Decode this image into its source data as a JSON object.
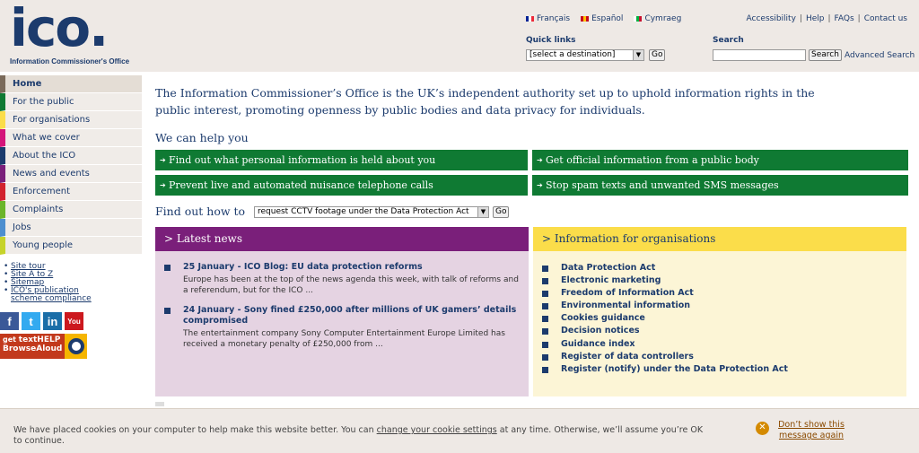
{
  "brand": {
    "logo": "ico.",
    "tagline": "Information Commissioner's Office"
  },
  "languages": [
    {
      "label": "Français",
      "flag": [
        "#002395",
        "#ffffff",
        "#ed2939"
      ]
    },
    {
      "label": "Español",
      "flag": [
        "#c60b1e",
        "#ffc400",
        "#c60b1e"
      ]
    },
    {
      "label": "Cymraeg",
      "flag": [
        "#ffffff",
        "#00b140",
        "#c8102e"
      ]
    }
  ],
  "utility_links": [
    "Accessibility",
    "Help",
    "FAQs",
    "Contact us"
  ],
  "quick_links": {
    "label": "Quick links",
    "selected": "[select a destination]",
    "go": "Go"
  },
  "search": {
    "label": "Search",
    "button": "Search",
    "advanced": "Advanced Search",
    "value": ""
  },
  "nav": [
    {
      "label": "Home",
      "color": "#7a6a5a"
    },
    {
      "label": "For the public",
      "color": "#0f7a33"
    },
    {
      "label": "For organisations",
      "color": "#fbdd4a"
    },
    {
      "label": "What we cover",
      "color": "#d4157a"
    },
    {
      "label": "About the ICO",
      "color": "#1c3b6d"
    },
    {
      "label": "News and events",
      "color": "#7a1f7a"
    },
    {
      "label": "Enforcement",
      "color": "#d2222d"
    },
    {
      "label": "Complaints",
      "color": "#6bb52a"
    },
    {
      "label": "Jobs",
      "color": "#4e8fcf"
    },
    {
      "label": "Young people",
      "color": "#c6d32a"
    }
  ],
  "side_links": [
    "Site tour",
    "Site A to Z",
    "Sitemap",
    "ICO's publication scheme compliance"
  ],
  "social": [
    {
      "icon": "facebook-icon",
      "glyph": "f",
      "color": "#3b5998"
    },
    {
      "icon": "twitter-icon",
      "glyph": "t",
      "color": "#33aaf0"
    },
    {
      "icon": "linkedin-icon",
      "glyph": "in",
      "color": "#1a6ea8"
    },
    {
      "icon": "youtube-icon",
      "glyph": "You",
      "color": "#cc181e"
    }
  ],
  "browsealoud": {
    "line1": "get",
    "line2": "textHELP",
    "line3": "BrowseAloud"
  },
  "intro": "The Information Commissioner’s Office is the UK’s independent authority set up to uphold information rights in the public interest, promoting openness by public bodies and data privacy for individuals.",
  "help": {
    "title": "We can help you",
    "buttons": [
      "Find out what personal information is held about you",
      "Get official information from a public body",
      "Prevent live and automated nuisance telephone calls",
      "Stop spam texts and unwanted SMS messages"
    ]
  },
  "find_out": {
    "label": "Find out how to",
    "selected": "request CCTV footage under the Data Protection Act",
    "go": "Go"
  },
  "latest_news": {
    "title": "> Latest news",
    "items": [
      {
        "headline": "25 January - ICO Blog: EU data protection reforms",
        "body": "Europe has been at the top of the news agenda this week, with talk of reforms and a referendum, but for the ICO ..."
      },
      {
        "headline": "24 January - Sony fined £250,000 after millions of UK gamers’ details compromised",
        "body": "The entertainment company Sony Computer Entertainment Europe Limited has received a monetary penalty of £250,000 from ..."
      }
    ]
  },
  "org_info": {
    "title": "> Information for organisations",
    "items": [
      "Data Protection Act",
      "Electronic marketing",
      "Freedom of Information Act",
      "Environmental information",
      "Cookies guidance",
      "Decision notices",
      "Guidance index",
      "Register of data controllers",
      "Register (notify) under the Data Protection Act"
    ]
  },
  "cookie": {
    "text_before": "We have placed cookies on your computer to help make this website better. You can ",
    "link": "change your cookie settings",
    "text_after": " at any time. Otherwise, we’ll assume you’re OK to continue.",
    "dismiss": "Don’t show this message again"
  }
}
